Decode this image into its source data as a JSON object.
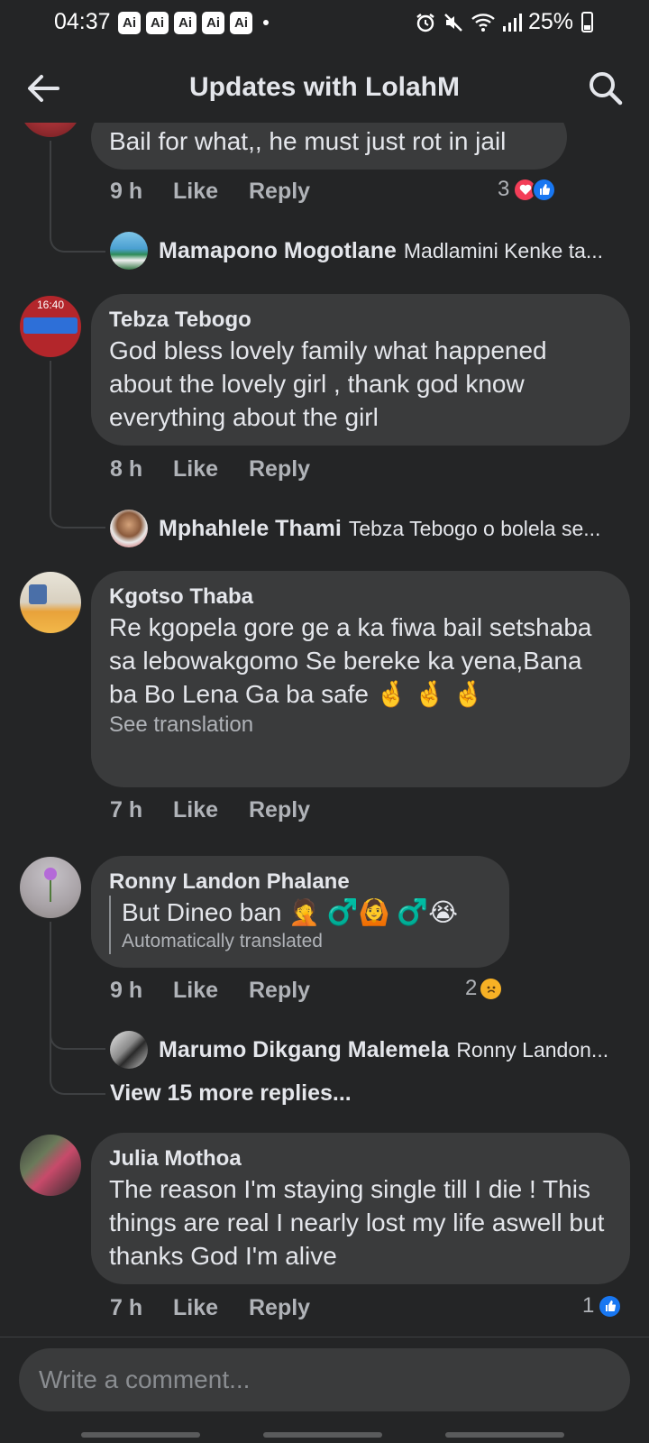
{
  "status_bar": {
    "time": "04:37",
    "ai_badges": [
      "Ai",
      "Ai",
      "Ai",
      "Ai",
      "Ai"
    ],
    "battery": "25%",
    "icons": [
      "alarm-icon",
      "mute-icon",
      "wifi-icon",
      "signal-icon",
      "battery-icon"
    ]
  },
  "header": {
    "title": "Updates with LolahM",
    "back_icon": "back-arrow-icon",
    "search_icon": "search-icon"
  },
  "comments": [
    {
      "text": "Bail for what,, he must just rot in jail",
      "time": "9 h",
      "like": "Like",
      "reply": "Reply",
      "reaction_count": "3",
      "reaction_icons": [
        "love",
        "like"
      ],
      "replies": [
        {
          "name": "Mamapono Mogotlane",
          "text": "Madlamini Kenke ta..."
        }
      ]
    },
    {
      "author": "Tebza Tebogo",
      "avatar_text": "16:40",
      "text": "God bless lovely family what happened about the lovely girl , thank god know everything about the girl",
      "time": "8 h",
      "like": "Like",
      "reply": "Reply",
      "replies": [
        {
          "name": "Mphahlele Thami",
          "text": "Tebza Tebogo o bolela se..."
        }
      ]
    },
    {
      "author": "Kgotso Thaba",
      "text": "Re kgopela gore ge a ka fiwa bail setshaba sa lebowakgomo Se bereke ka yena,Bana ba Bo Lena Ga ba safe 🤞 🤞 🤞",
      "see_translation": "See translation",
      "time": "7 h",
      "like": "Like",
      "reply": "Reply"
    },
    {
      "author": "Ronny Landon Phalane",
      "text": "But Dineo ban 🤦 ♂️🙆 ♂️😭",
      "auto_translated": "Automatically translated",
      "time": "9 h",
      "like": "Like",
      "reply": "Reply",
      "reaction_count": "2",
      "reaction_icons": [
        "sad"
      ],
      "replies": [
        {
          "name": "Marumo Dikgang Malemela",
          "text": "Ronny Landon..."
        }
      ],
      "view_more": "View 15 more replies..."
    },
    {
      "author": "Julia Mothoa",
      "text": "The reason I'm staying single till I die ! This things are  real I nearly lost my life aswell but thanks God I'm alive",
      "time": "7 h",
      "like": "Like",
      "reply": "Reply",
      "reaction_count": "1",
      "reaction_icons": [
        "like"
      ]
    }
  ],
  "composer": {
    "placeholder": "Write a comment..."
  },
  "colors": {
    "background": "#242526",
    "bubble": "#3a3b3c",
    "text": "#e4e6eb",
    "muted": "#b0b3b8",
    "like_blue": "#1877f2",
    "love_red": "#f33e58"
  }
}
